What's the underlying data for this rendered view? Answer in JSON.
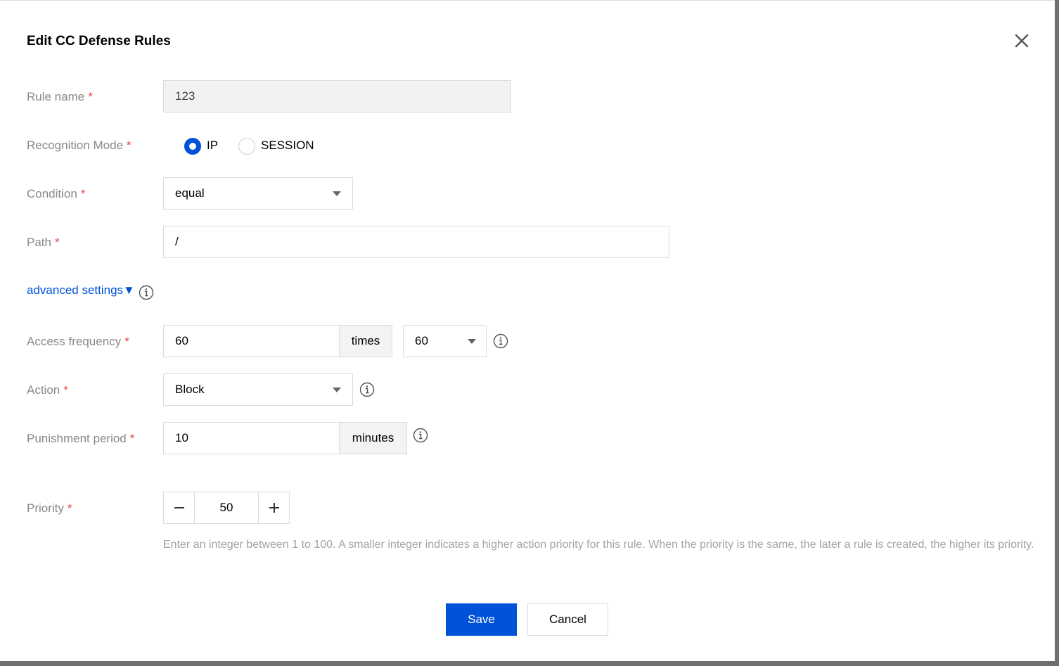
{
  "dialog": {
    "title": "Edit CC Defense Rules"
  },
  "required_mark": "*",
  "fields": {
    "rule_name": {
      "label": "Rule name",
      "value": "123"
    },
    "recognition_mode": {
      "label": "Recognition Mode",
      "options": [
        "IP",
        "SESSION"
      ],
      "selected": "IP"
    },
    "condition": {
      "label": "Condition",
      "value": "equal"
    },
    "path": {
      "label": "Path",
      "value": "/"
    },
    "advanced_settings": {
      "label": "advanced settings▼"
    },
    "access_frequency": {
      "label": "Access frequency",
      "value": "60",
      "unit": "times",
      "period": "60"
    },
    "action": {
      "label": "Action",
      "value": "Block"
    },
    "punishment_period": {
      "label": "Punishment period",
      "value": "10",
      "unit": "minutes"
    },
    "priority": {
      "label": "Priority",
      "value": "50",
      "help": "Enter an integer between 1 to 100. A smaller integer indicates a higher action priority for this rule. When the priority is the same, the later a rule is created, the higher its priority."
    }
  },
  "buttons": {
    "save": "Save",
    "cancel": "Cancel"
  },
  "colors": {
    "primary": "#0052d9",
    "required": "#e54545",
    "label": "#888888"
  }
}
